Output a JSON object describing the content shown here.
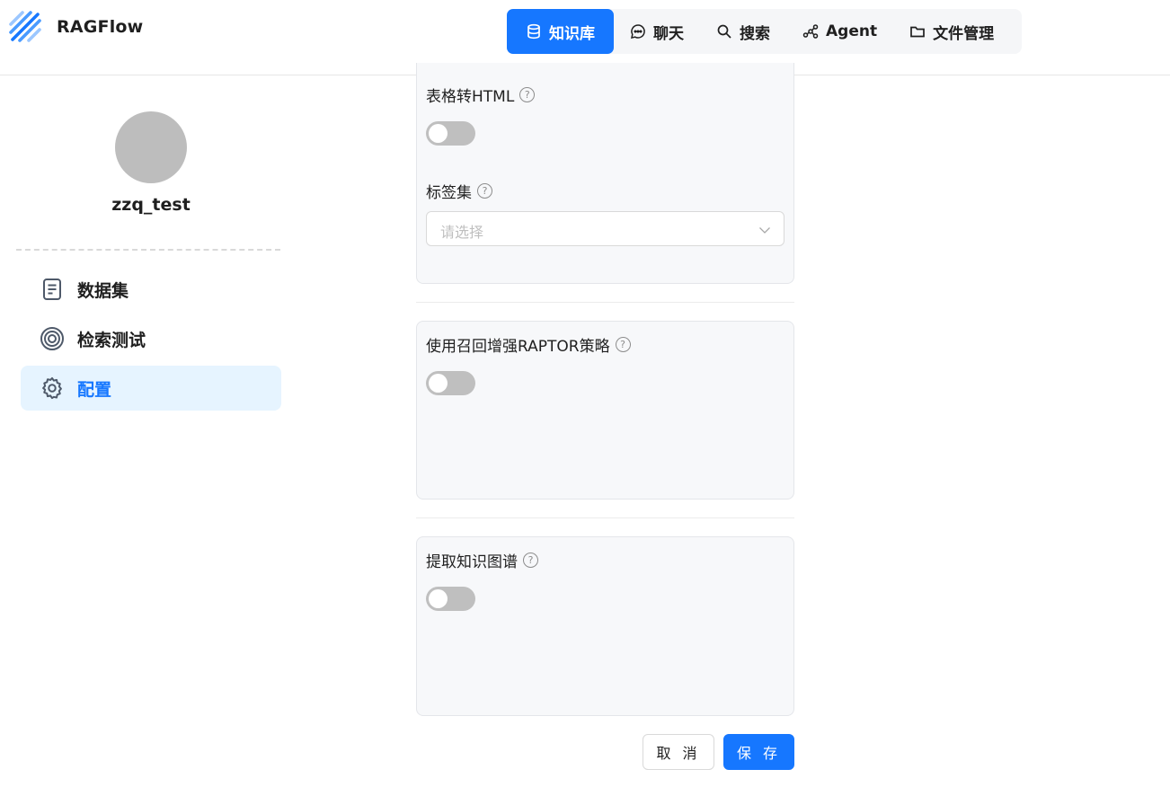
{
  "app": {
    "title": "RAGFlow"
  },
  "nav": {
    "items": [
      {
        "label": "知识库",
        "icon": "database-icon",
        "active": true
      },
      {
        "label": "聊天",
        "icon": "chat-icon"
      },
      {
        "label": "搜索",
        "icon": "search-icon"
      },
      {
        "label": "Agent",
        "icon": "graph-icon"
      },
      {
        "label": "文件管理",
        "icon": "folder-icon"
      }
    ]
  },
  "sidebar": {
    "kb_name": "zzq_test",
    "items": [
      {
        "label": "数据集",
        "icon": "document-icon"
      },
      {
        "label": "检索测试",
        "icon": "target-icon"
      },
      {
        "label": "配置",
        "icon": "gear-icon",
        "active": true
      }
    ]
  },
  "form": {
    "table_to_html": {
      "label": "表格转HTML",
      "enabled": false
    },
    "tag_set": {
      "label": "标签集",
      "placeholder": "请选择"
    },
    "raptor": {
      "label": "使用召回增强RAPTOR策略",
      "enabled": false
    },
    "knowledge_graph": {
      "label": "提取知识图谱",
      "enabled": false
    },
    "help_glyph": "?"
  },
  "actions": {
    "cancel": "取 消",
    "save": "保 存"
  },
  "colors": {
    "accent": "#1677ff",
    "sidebar_active_bg": "#e6f4ff",
    "switch_off": "#bfbfbf"
  }
}
